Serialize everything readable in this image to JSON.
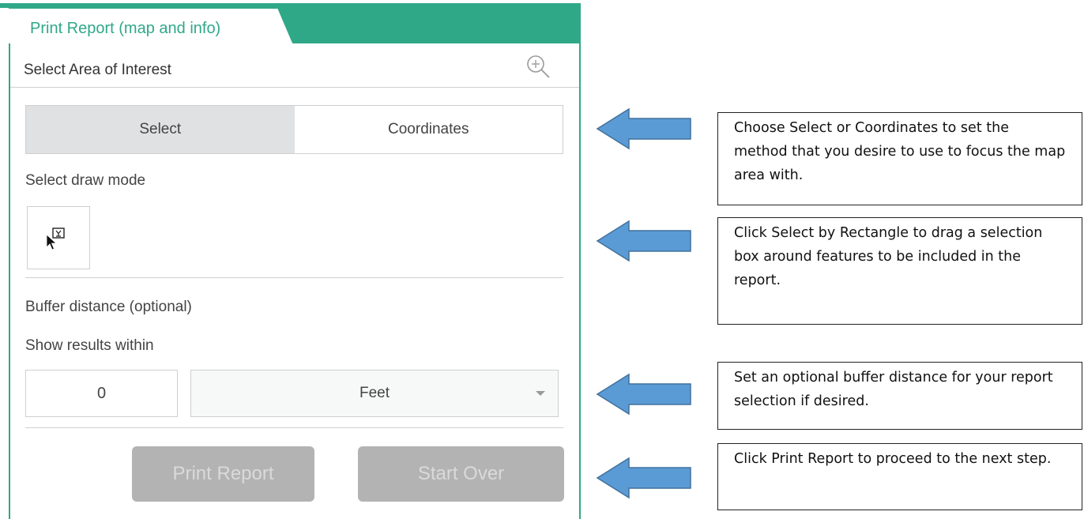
{
  "panel": {
    "tab_title": "Print Report (map and info)",
    "heading": "Select Area of Interest",
    "zoom_icon": "zoom-in-icon",
    "accent_color": "#2fa888"
  },
  "method_toggle": {
    "options": [
      "Select",
      "Coordinates"
    ],
    "selected": "Select"
  },
  "draw_mode": {
    "label": "Select draw mode",
    "tool_icon": "select-by-rectangle-icon"
  },
  "buffer": {
    "label": "Buffer distance (optional)",
    "sublabel": "Show results within",
    "distance_value": "0",
    "unit_selected": "Feet"
  },
  "actions": {
    "print_label": "Print Report",
    "start_over_label": "Start Over",
    "disabled_color": "#b3b3b3"
  },
  "annotations": {
    "arrow_color": "#5b9bd5",
    "callouts": [
      "Choose Select or Coordinates to set the method that you desire to use to focus the map area with.",
      "Click Select by Rectangle to drag a selection box around features to be included in the report.",
      "Set an optional buffer distance for your report selection if desired.",
      "Click Print Report to proceed to the next step."
    ]
  }
}
